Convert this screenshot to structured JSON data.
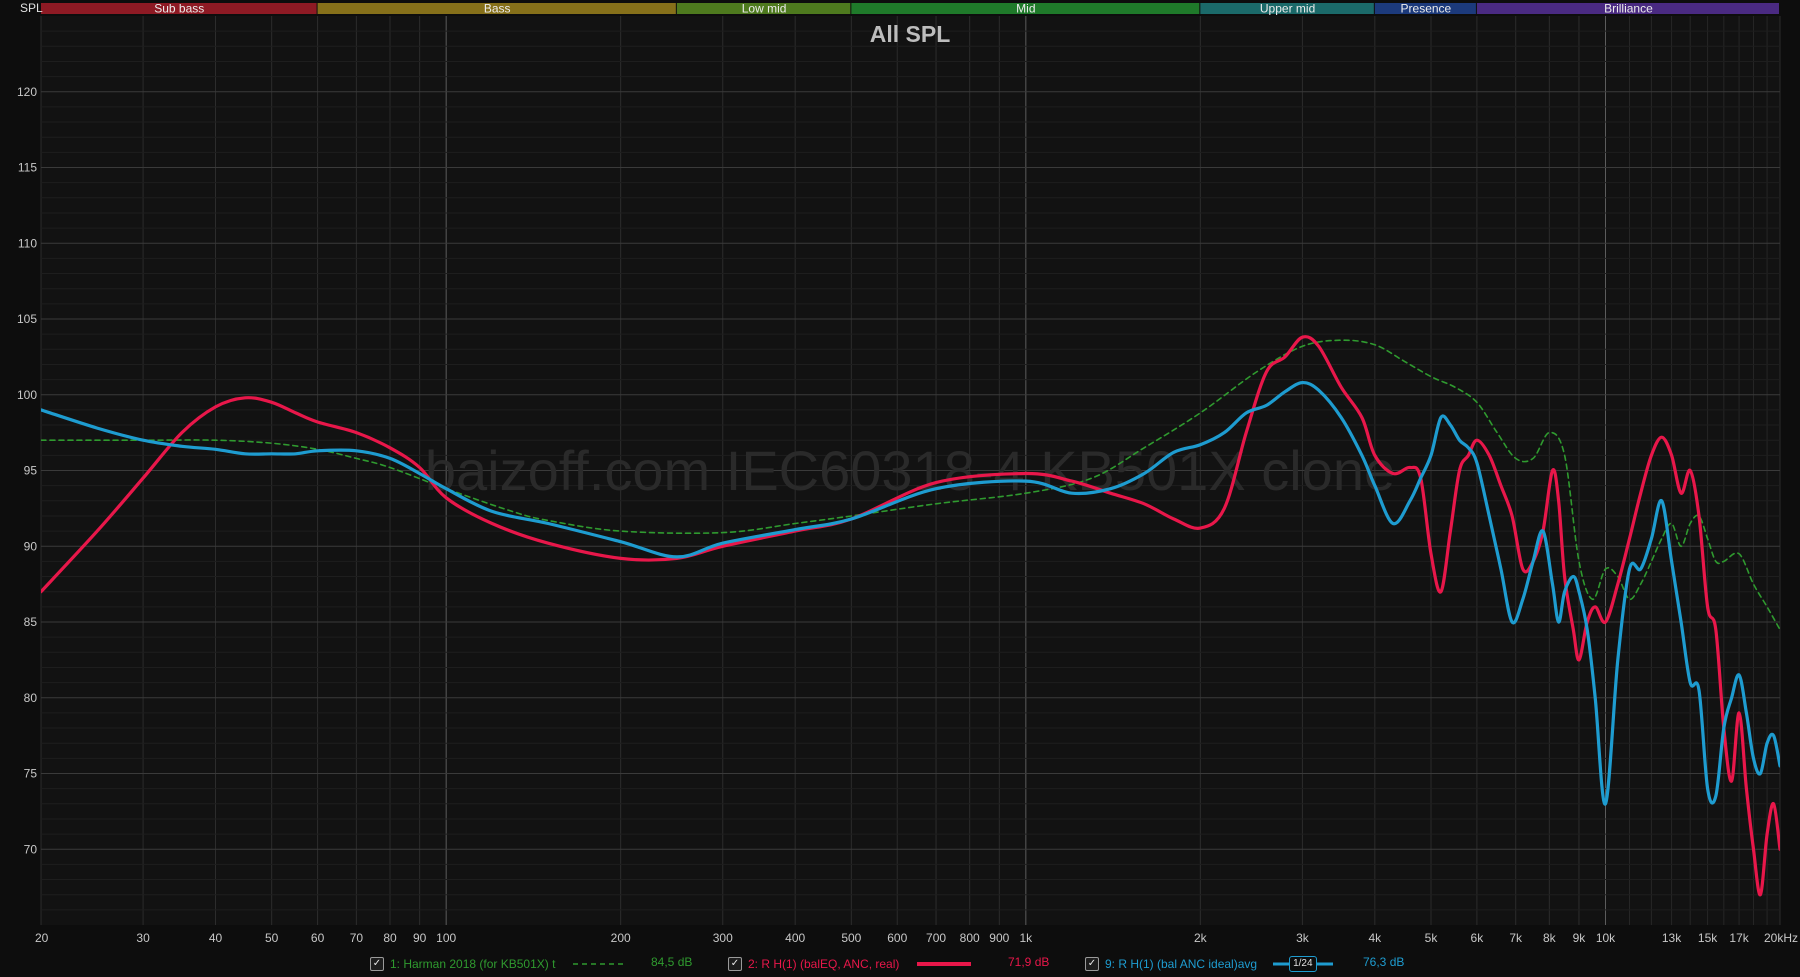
{
  "header": {
    "spl_label": "SPL"
  },
  "bands": [
    {
      "name": "Sub bass",
      "from": 20,
      "to": 60,
      "color": "#8e1a24"
    },
    {
      "name": "Bass",
      "from": 60,
      "to": 250,
      "color": "#86701a"
    },
    {
      "name": "Low mid",
      "from": 250,
      "to": 500,
      "color": "#4e7a1e"
    },
    {
      "name": "Mid",
      "from": 500,
      "to": 2000,
      "color": "#1f7a2a"
    },
    {
      "name": "Upper mid",
      "from": 2000,
      "to": 4000,
      "color": "#1b6a6a"
    },
    {
      "name": "Presence",
      "from": 4000,
      "to": 6000,
      "color": "#1c3a7c"
    },
    {
      "name": "Brilliance",
      "from": 6000,
      "to": 20000,
      "color": "#4a2a82"
    }
  ],
  "watermark": "baizoff.com IEC60318-4 KB501X clone",
  "legend": {
    "items": [
      {
        "label": "1: Harman 2018 (for KB501X) t",
        "value": "84,5 dB",
        "color": "#2f9a2f",
        "style": "dashed"
      },
      {
        "label": "2: R H(1) (balEQ, ANC, real)",
        "value": "71,9 dB",
        "color": "#e8174a",
        "style": "solid"
      },
      {
        "label": "9: R H(1) (bal ANC ideal)avg",
        "value": "76,3 dB",
        "color": "#1e9cd0",
        "style": "smoothing",
        "smoothing_label": "1/24"
      }
    ]
  },
  "chart_data": {
    "type": "line",
    "title": "All SPL",
    "ylabel": "SPL",
    "x_scale": "log",
    "xlim": [
      20,
      20000
    ],
    "ylim": [
      65,
      125
    ],
    "x_ticks": [
      {
        "v": 20,
        "l": "20"
      },
      {
        "v": 30,
        "l": "30"
      },
      {
        "v": 40,
        "l": "40"
      },
      {
        "v": 50,
        "l": "50"
      },
      {
        "v": 60,
        "l": "60"
      },
      {
        "v": 70,
        "l": "70"
      },
      {
        "v": 80,
        "l": "80"
      },
      {
        "v": 90,
        "l": "90"
      },
      {
        "v": 100,
        "l": "100"
      },
      {
        "v": 200,
        "l": "200"
      },
      {
        "v": 300,
        "l": "300"
      },
      {
        "v": 400,
        "l": "400"
      },
      {
        "v": 500,
        "l": "500"
      },
      {
        "v": 600,
        "l": "600"
      },
      {
        "v": 700,
        "l": "700"
      },
      {
        "v": 800,
        "l": "800"
      },
      {
        "v": 900,
        "l": "900"
      },
      {
        "v": 1000,
        "l": "1k"
      },
      {
        "v": 2000,
        "l": "2k"
      },
      {
        "v": 3000,
        "l": "3k"
      },
      {
        "v": 4000,
        "l": "4k"
      },
      {
        "v": 5000,
        "l": "5k"
      },
      {
        "v": 6000,
        "l": "6k"
      },
      {
        "v": 7000,
        "l": "7k"
      },
      {
        "v": 8000,
        "l": "8k"
      },
      {
        "v": 9000,
        "l": "9k"
      },
      {
        "v": 10000,
        "l": "10k"
      },
      {
        "v": 13000,
        "l": "13k"
      },
      {
        "v": 15000,
        "l": "15k"
      },
      {
        "v": 17000,
        "l": "17k"
      },
      {
        "v": 20000,
        "l": "20kHz"
      }
    ],
    "y_ticks": [
      70,
      75,
      80,
      85,
      90,
      95,
      100,
      105,
      110,
      115,
      120
    ],
    "grid": true,
    "legend_position": "bottom",
    "series": [
      {
        "name": "1: Harman 2018 (for KB501X) t",
        "color": "#2f9a2f",
        "dashed": true,
        "width": 1.6,
        "x": [
          20,
          30,
          40,
          50,
          60,
          70,
          80,
          100,
          130,
          150,
          200,
          300,
          400,
          500,
          700,
          1000,
          1300,
          1600,
          2000,
          2500,
          3000,
          3500,
          4000,
          4500,
          5000,
          5500,
          6000,
          6500,
          7000,
          7500,
          8000,
          8500,
          9000,
          9500,
          10000,
          10500,
          11000,
          11500,
          12000,
          12500,
          13000,
          13500,
          14000,
          14500,
          15000,
          15500,
          16000,
          17000,
          18000,
          19000,
          20000
        ],
        "y": [
          97,
          97,
          97,
          96.8,
          96.4,
          95.8,
          95.2,
          93.8,
          92.3,
          91.7,
          91.0,
          90.9,
          91.5,
          92.0,
          92.8,
          93.5,
          94.5,
          96.5,
          98.8,
          101.5,
          103.2,
          103.6,
          103.3,
          102.2,
          101.2,
          100.5,
          99.5,
          97.5,
          95.8,
          95.8,
          97.5,
          96.0,
          89.0,
          86.5,
          88.5,
          88.0,
          86.5,
          87.5,
          89.0,
          90.5,
          91.5,
          90.0,
          91.5,
          92.0,
          90.5,
          89.0,
          89.0,
          89.5,
          87.5,
          86.0,
          84.5
        ]
      },
      {
        "name": "2: R H(1) (balEQ, ANC, real)",
        "color": "#e8174a",
        "dashed": false,
        "width": 3.2,
        "x": [
          20,
          25,
          30,
          35,
          40,
          45,
          50,
          55,
          60,
          70,
          80,
          90,
          100,
          120,
          150,
          200,
          250,
          300,
          400,
          500,
          700,
          1000,
          1200,
          1400,
          1600,
          1800,
          2000,
          2200,
          2400,
          2600,
          2800,
          3000,
          3200,
          3500,
          3800,
          4000,
          4300,
          4600,
          4800,
          5000,
          5200,
          5400,
          5600,
          5800,
          6000,
          6300,
          6600,
          6900,
          7200,
          7500,
          7800,
          8100,
          8300,
          8500,
          8800,
          9000,
          9300,
          9600,
          10000,
          10500,
          11000,
          11500,
          12000,
          12500,
          13000,
          13500,
          14000,
          14500,
          15000,
          15500,
          16000,
          16500,
          17000,
          17500,
          18000,
          18500,
          19000,
          19500,
          20000
        ],
        "y": [
          87,
          91,
          94.5,
          97.5,
          99.2,
          99.8,
          99.5,
          98.8,
          98.2,
          97.5,
          96.5,
          95.2,
          93.2,
          91.5,
          90.2,
          89.2,
          89.2,
          90.0,
          91.0,
          91.8,
          94.2,
          94.8,
          94.3,
          93.5,
          92.8,
          91.8,
          91.2,
          92.5,
          97.5,
          101.5,
          102.5,
          103.8,
          103.2,
          100.5,
          98.5,
          96.0,
          94.8,
          95.2,
          94.5,
          89.5,
          87.0,
          91.0,
          95.0,
          96.0,
          97.0,
          96.0,
          94.0,
          92.0,
          88.5,
          89.0,
          91.0,
          95.0,
          93.0,
          88.0,
          84.5,
          82.5,
          85.0,
          86.0,
          85.0,
          87.5,
          90.5,
          93.5,
          96.0,
          97.2,
          96.0,
          93.5,
          95.0,
          92.0,
          86.0,
          84.5,
          78.0,
          74.5,
          79.0,
          74.0,
          70.0,
          67.0,
          71.0,
          73.0,
          70.0
        ]
      },
      {
        "name": "9: R H(1) (bal ANC ideal)avg",
        "color": "#1e9cd0",
        "dashed": false,
        "width": 3.2,
        "x": [
          20,
          25,
          30,
          35,
          40,
          45,
          50,
          55,
          60,
          70,
          80,
          90,
          100,
          120,
          150,
          200,
          250,
          300,
          400,
          500,
          700,
          1000,
          1200,
          1400,
          1600,
          1800,
          2000,
          2200,
          2400,
          2600,
          2800,
          3000,
          3200,
          3500,
          3800,
          4000,
          4300,
          4600,
          4800,
          5000,
          5200,
          5400,
          5600,
          5800,
          6000,
          6300,
          6600,
          6900,
          7200,
          7500,
          7800,
          8100,
          8300,
          8500,
          8800,
          9000,
          9300,
          9600,
          10000,
          10500,
          11000,
          11500,
          12000,
          12500,
          13000,
          13500,
          14000,
          14500,
          15000,
          15500,
          16000,
          16500,
          17000,
          17500,
          18000,
          18500,
          19000,
          19500,
          20000
        ],
        "y": [
          99,
          97.8,
          97.0,
          96.6,
          96.4,
          96.1,
          96.1,
          96.1,
          96.3,
          96.3,
          95.8,
          94.8,
          93.8,
          92.3,
          91.5,
          90.3,
          89.3,
          90.2,
          91.1,
          91.8,
          93.8,
          94.3,
          93.5,
          93.8,
          94.8,
          96.2,
          96.7,
          97.5,
          98.8,
          99.3,
          100.2,
          100.8,
          100.3,
          98.5,
          96.0,
          94.0,
          91.5,
          93.0,
          94.5,
          96.0,
          98.5,
          98.0,
          97.0,
          96.5,
          95.5,
          92.0,
          88.5,
          85.0,
          86.5,
          89.0,
          91.0,
          87.5,
          85.0,
          87.0,
          88.0,
          87.0,
          84.5,
          80.0,
          73.0,
          82.5,
          88.5,
          88.5,
          90.5,
          93.0,
          89.0,
          85.0,
          81.0,
          80.5,
          74.0,
          73.5,
          78.0,
          80.0,
          81.5,
          79.0,
          76.0,
          75.0,
          77.0,
          77.5,
          75.5
        ]
      }
    ]
  }
}
